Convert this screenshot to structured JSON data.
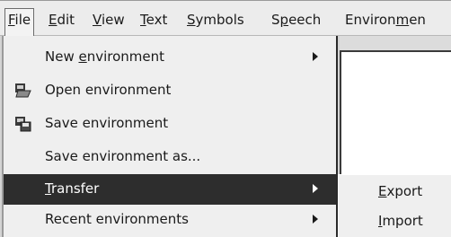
{
  "menubar": {
    "items": [
      {
        "pre": "",
        "u": "F",
        "post": "ile"
      },
      {
        "pre": "",
        "u": "E",
        "post": "dit"
      },
      {
        "pre": "",
        "u": "V",
        "post": "iew"
      },
      {
        "pre": "",
        "u": "T",
        "post": "ext"
      },
      {
        "pre": "",
        "u": "S",
        "post": "ymbols"
      },
      {
        "pre": "S",
        "u": "p",
        "post": "eech"
      },
      {
        "pre": "Environ",
        "u": "m",
        "post": "en"
      }
    ]
  },
  "file_menu": {
    "items": [
      {
        "pre": "New ",
        "u": "e",
        "post": "nvironment",
        "icon": "",
        "submenu": true
      },
      {
        "pre": "Open environment",
        "u": "",
        "post": "",
        "icon": "open-folder-icon",
        "submenu": false
      },
      {
        "pre": "Save environment",
        "u": "",
        "post": "",
        "icon": "save-disk-icon",
        "submenu": false
      },
      {
        "pre": "Save environment as...",
        "u": "",
        "post": "",
        "icon": "",
        "submenu": false
      },
      {
        "pre": "",
        "u": "T",
        "post": "ransfer",
        "icon": "",
        "submenu": true,
        "highlighted": true
      },
      {
        "pre": "Recent environments",
        "u": "",
        "post": "",
        "icon": "",
        "submenu": true
      }
    ]
  },
  "transfer_submenu": {
    "items": [
      {
        "pre": "",
        "u": "E",
        "post": "xport"
      },
      {
        "pre": "",
        "u": "I",
        "post": "mport"
      }
    ]
  }
}
